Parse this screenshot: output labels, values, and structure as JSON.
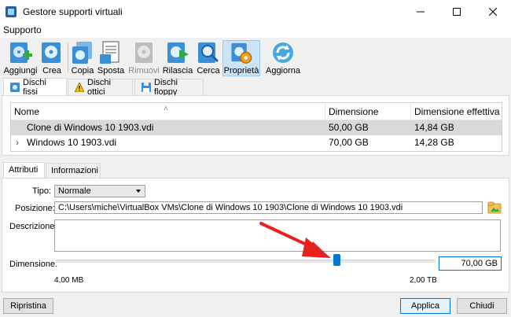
{
  "window": {
    "title": "Gestore supporti virtuali"
  },
  "menu": {
    "items": [
      "Supporto"
    ]
  },
  "toolbar": {
    "buttons": [
      {
        "label": "Aggiungi",
        "icon": "add-disk-icon",
        "enabled": true
      },
      {
        "label": "Crea",
        "icon": "create-disk-icon",
        "enabled": true
      },
      {
        "label": "Copia",
        "icon": "copy-disk-icon",
        "enabled": true
      },
      {
        "label": "Sposta",
        "icon": "move-disk-icon",
        "enabled": true
      },
      {
        "label": "Rimuovi",
        "icon": "remove-disk-icon",
        "enabled": false
      },
      {
        "label": "Rilascia",
        "icon": "release-disk-icon",
        "enabled": true
      },
      {
        "label": "Cerca",
        "icon": "search-disk-icon",
        "enabled": true
      },
      {
        "label": "Proprietà",
        "icon": "properties-gear-icon",
        "enabled": true,
        "active": true
      },
      {
        "label": "Aggiorna",
        "icon": "refresh-icon",
        "enabled": true
      }
    ]
  },
  "media_tabs": [
    {
      "label": "Dischi fissi",
      "selected": true
    },
    {
      "label": "Dischi ottici",
      "selected": false
    },
    {
      "label": "Dischi floppy",
      "selected": false
    }
  ],
  "table": {
    "columns": [
      "Nome",
      "Dimensione virtuale",
      "Dimensione effettiva"
    ],
    "rows": [
      {
        "name": "Clone di Windows 10 1903.vdi",
        "virtual_size": "50,00 GB",
        "actual_size": "14,84 GB",
        "selected": true
      },
      {
        "name": "Windows 10 1903.vdi",
        "virtual_size": "70,00 GB",
        "actual_size": "14,28 GB",
        "selected": false,
        "expander": "›"
      }
    ]
  },
  "detail_tabs": [
    {
      "label": "Attributi",
      "selected": true
    },
    {
      "label": "Informazioni",
      "selected": false
    }
  ],
  "attributes": {
    "type_label": "Tipo:",
    "type_value": "Normale",
    "position_label": "Posizione:",
    "position_value": "C:\\Users\\miche\\VirtualBox VMs\\Clone di Windows 10 1903\\Clone di Windows 10 1903.vdi",
    "description_label": "Descrizione:",
    "description_value": "",
    "size_label": "Dimensione:",
    "size_value": "70,00 GB",
    "slider_min": "4,00 MB",
    "slider_max": "2,00 TB",
    "slider_level": 0.74
  },
  "buttons": {
    "reset": "Ripristina",
    "apply": "Applica",
    "close": "Chiudi"
  },
  "colors": {
    "accent": "#0078d7",
    "annotation_arrow": "#e8201e"
  }
}
